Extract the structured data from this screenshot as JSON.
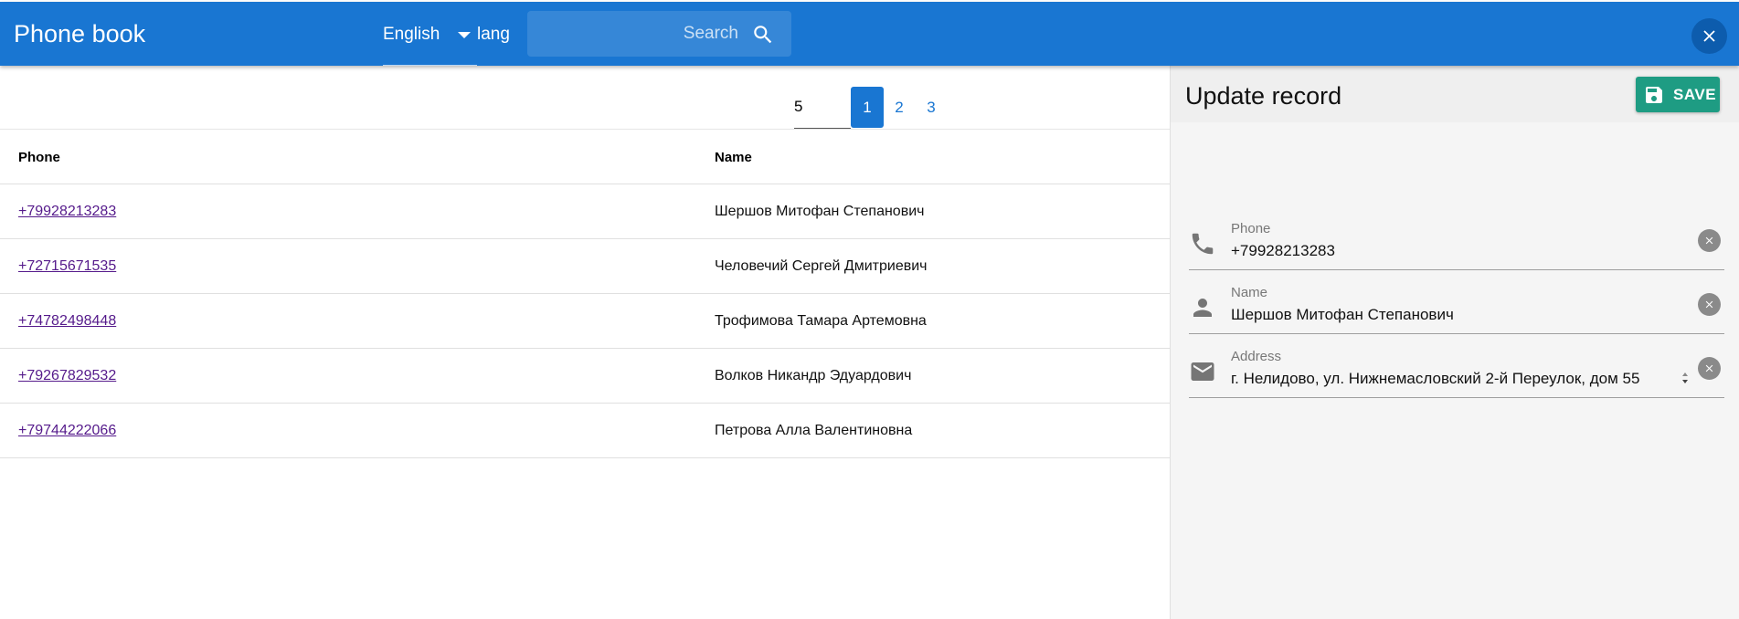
{
  "header": {
    "title": "Phone book",
    "language": "English",
    "lang_label": "lang",
    "search_placeholder": "Search"
  },
  "pagination": {
    "page_size": "5",
    "pages": [
      "1",
      "2",
      "3"
    ],
    "current": "1"
  },
  "table": {
    "columns": [
      "Phone",
      "Name"
    ],
    "rows": [
      {
        "phone": "+79928213283",
        "name": "Шершов Митофан Степанович"
      },
      {
        "phone": "+72715671535",
        "name": "Человечий Сергей Дмитриевич"
      },
      {
        "phone": "+74782498448",
        "name": "Трофимова Тамара Артемовна"
      },
      {
        "phone": "+79267829532",
        "name": "Волков Никандр Эдуардович"
      },
      {
        "phone": "+79744222066",
        "name": "Петрова Алла Валентиновна"
      }
    ]
  },
  "panel": {
    "title": "Update record",
    "save_label": "SAVE",
    "fields": [
      {
        "label": "Phone",
        "value": "+79928213283",
        "icon": "phone-icon"
      },
      {
        "label": "Name",
        "value": "Шершов Митофан Степанович",
        "icon": "person-icon"
      },
      {
        "label": "Address",
        "value": "г. Нелидово, ул. Нижнемасловский 2-й Переулок, дом 55",
        "icon": "mail-icon"
      }
    ]
  },
  "colors": {
    "primary": "#1976d2",
    "save": "#1e9c83",
    "link": "#551a8b"
  }
}
